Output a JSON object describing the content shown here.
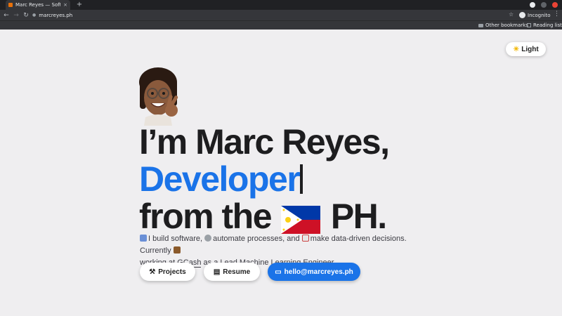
{
  "browser": {
    "tab_title": "Marc Reyes — Software E",
    "tab_close": "×",
    "new_tab": "+",
    "url": "marcreyes.ph",
    "profile_label": "Incognito",
    "bookmarks": {
      "other": "Other bookmarks",
      "reading_list": "Reading list"
    }
  },
  "theme_toggle": {
    "label": "Light",
    "icon": "sun-icon"
  },
  "hero": {
    "line1": "I’m Marc Reyes,",
    "role": "Developer",
    "line3_prefix": "from the",
    "line3_suffix": "PH."
  },
  "bio": {
    "part1": "I build software,",
    "part2": "automate processes, and",
    "part3": "make data-driven decisions. Currently",
    "part4": "working at",
    "company": "GCash",
    "part5": "as a Lead Machine Learning Engineer."
  },
  "actions": {
    "projects": "Projects",
    "resume": "Resume",
    "email": "hello@marcreyes.ph"
  },
  "colors": {
    "accent": "#1a73e8",
    "text": "#1d1d1f",
    "background": "#efeef0"
  }
}
